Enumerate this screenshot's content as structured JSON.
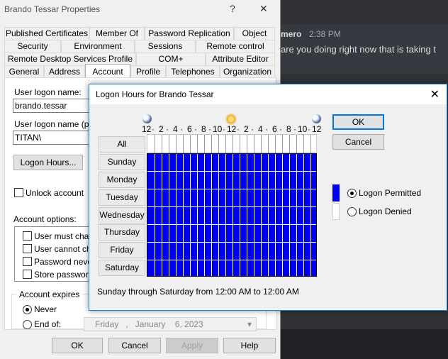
{
  "background_chat": {
    "user": "mero",
    "time": "2:38 PM",
    "message": "are you doing right now that is taking t"
  },
  "properties": {
    "title": "Brando Tessar Properties",
    "help_glyph": "?",
    "close_glyph": "✕",
    "tabs_row1": [
      "Published Certificates",
      "Member Of",
      "Password Replication",
      "Object"
    ],
    "tabs_row2": [
      "Security",
      "Environment",
      "Sessions",
      "Remote control"
    ],
    "tabs_row3": [
      "Remote Desktop Services Profile",
      "COM+",
      "Attribute Editor"
    ],
    "tabs_row4": [
      "General",
      "Address",
      "Account",
      "Profile",
      "Telephones",
      "Organization"
    ],
    "active_tab": "Account",
    "user_logon_name_label": "User logon name:",
    "user_logon_name_value": "brando.tessar",
    "pre_windows_label": "User logon name (pre-W",
    "pre_windows_value": "TITAN\\",
    "logon_hours_button": "Logon Hours...",
    "unlock_account_label": "Unlock account",
    "account_options_label": "Account options:",
    "account_options": [
      "User must chang",
      "User cannot cha",
      "Password never",
      "Store password u"
    ],
    "account_expires_label": "Account expires",
    "never_label": "Never",
    "end_of_label": "End of:",
    "end_of_date": "Friday   ,   January    6, 2023",
    "date_dropdown_glyph": "▾",
    "ok": "OK",
    "cancel": "Cancel",
    "apply": "Apply",
    "help": "Help"
  },
  "logon_hours": {
    "title": "Logon Hours for Brando Tessar",
    "close_glyph": "✕",
    "hour_labels": [
      "12",
      "·",
      "2",
      "·",
      "4",
      "·",
      "6",
      "·",
      "8",
      "·",
      "10",
      "·",
      "12",
      "·",
      "2",
      "·",
      "4",
      "·",
      "6",
      "·",
      "8",
      "·",
      "10",
      "·",
      "12"
    ],
    "all_label": "All",
    "days": [
      "Sunday",
      "Monday",
      "Tuesday",
      "Wednesday",
      "Thursday",
      "Friday",
      "Saturday"
    ],
    "permitted_fraction": 1.0,
    "summary": "Sunday through Saturday from 12:00 AM to 12:00 AM",
    "ok": "OK",
    "cancel": "Cancel",
    "permitted_label": "Logon Permitted",
    "denied_label": "Logon Denied",
    "selected_legend": "Logon Permitted",
    "colors": {
      "permitted": "#0000ee",
      "denied": "#ffffff",
      "accent": "#0078d7"
    },
    "icons": {
      "midnight": "moon-icon",
      "noon": "sun-icon"
    }
  }
}
